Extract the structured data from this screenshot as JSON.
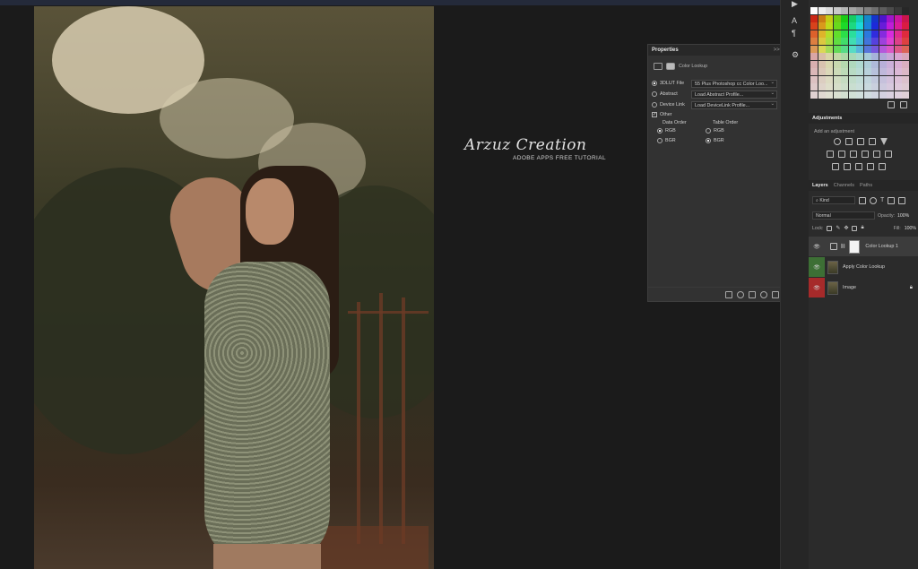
{
  "watermark": {
    "title": "Arzuz Creation",
    "subtitle": "ADOBE APPS FREE TUTORIAL"
  },
  "properties": {
    "title": "Properties",
    "subtitle": "Color Lookup",
    "collapse_label": ">>",
    "menu_label": "≡",
    "lut_file_label": "3DLUT File",
    "lut_file_value": "55 Plus Photoshop cc Color Loo...",
    "abstract_label": "Abstract",
    "abstract_value": "Load Abstract Profile...",
    "device_link_label": "Device Link",
    "device_link_value": "Load DeviceLink Profile...",
    "other_label": "Other",
    "data_order_label": "Data Order",
    "table_order_label": "Table Order",
    "rgb_label": "RGB",
    "bgr_label": "BGR"
  },
  "adjustments": {
    "tab_label": "Adjustments",
    "hint": "Add an adjustment"
  },
  "layers": {
    "tabs": [
      "Layers",
      "Channels",
      "Paths"
    ],
    "filter_kind": "Kind",
    "blend_mode": "Normal",
    "opacity_label": "Opacity:",
    "opacity_value": "100%",
    "lock_label": "Lock:",
    "fill_label": "Fill:",
    "fill_value": "100%",
    "items": [
      {
        "name": "Color Lookup 1",
        "eye_color": "#2b2b2b"
      },
      {
        "name": "Apply Color Lookup",
        "eye_color": "#3d6f35"
      },
      {
        "name": "Image",
        "eye_color": "#a62a2a"
      }
    ]
  },
  "colors": {
    "panel_bg": "#323232",
    "panel_header": "#282828",
    "green_tag": "#3d6f35",
    "red_tag": "#a62a2a"
  }
}
